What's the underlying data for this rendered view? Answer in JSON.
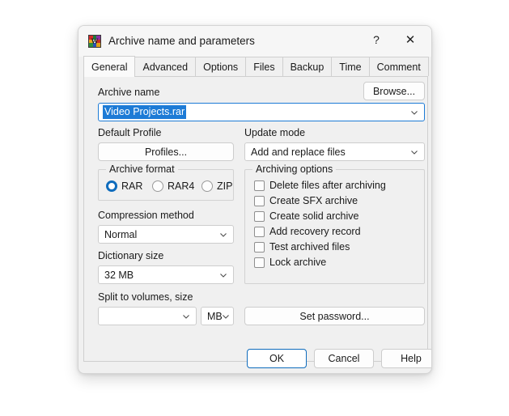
{
  "window": {
    "title": "Archive name and parameters",
    "icon": "winrar-books-icon",
    "help_label": "?",
    "close_label": "✕"
  },
  "tabs": [
    {
      "label": "General",
      "active": true
    },
    {
      "label": "Advanced",
      "active": false
    },
    {
      "label": "Options",
      "active": false
    },
    {
      "label": "Files",
      "active": false
    },
    {
      "label": "Backup",
      "active": false
    },
    {
      "label": "Time",
      "active": false
    },
    {
      "label": "Comment",
      "active": false
    }
  ],
  "general": {
    "archive_name_label": "Archive name",
    "browse_label": "Browse...",
    "archive_name_value": "Video Projects.rar",
    "default_profile_label": "Default Profile",
    "profiles_label": "Profiles...",
    "update_mode_label": "Update mode",
    "update_mode_value": "Add and replace files",
    "archive_format": {
      "title": "Archive format",
      "options": [
        {
          "label": "RAR",
          "selected": true
        },
        {
          "label": "RAR4",
          "selected": false
        },
        {
          "label": "ZIP",
          "selected": false
        }
      ]
    },
    "compression_method_label": "Compression method",
    "compression_method_value": "Normal",
    "dictionary_size_label": "Dictionary size",
    "dictionary_size_value": "32 MB",
    "split_label": "Split to volumes, size",
    "split_value": "",
    "split_unit_value": "MB",
    "archiving_options": {
      "title": "Archiving options",
      "items": [
        {
          "label": "Delete files after archiving",
          "checked": false
        },
        {
          "label": "Create SFX archive",
          "checked": false
        },
        {
          "label": "Create solid archive",
          "checked": false
        },
        {
          "label": "Add recovery record",
          "checked": false
        },
        {
          "label": "Test archived files",
          "checked": false
        },
        {
          "label": "Lock archive",
          "checked": false
        }
      ]
    },
    "set_password_label": "Set password..."
  },
  "footer": {
    "ok_label": "OK",
    "cancel_label": "Cancel",
    "help_label": "Help"
  },
  "colors": {
    "accent": "#0f6cbd",
    "selection": "#1d7bd6",
    "dialog_bg": "#f0f0f0",
    "field_bg": "#ffffff"
  }
}
